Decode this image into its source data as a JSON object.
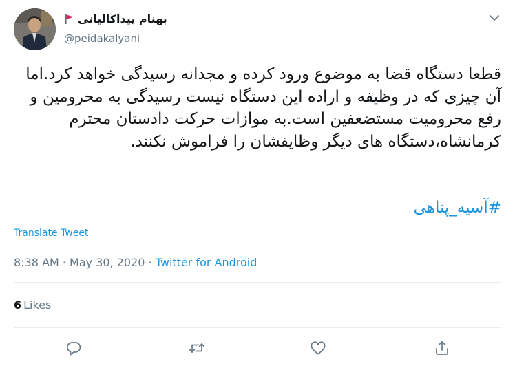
{
  "author": {
    "display_name": "بهنام پیداکالیانی",
    "handle": "@peidakalyani",
    "flag_icon": "red-flag-icon"
  },
  "tweet": {
    "text": "قطعا دستگاه قضا به موضوع ورود کرده و مجدانه رسیدگی خواهد کرد.اما آن چیزی که در وظیفه و اراده این دستگاه نیست رسیدگی به محرومین و رفع محرومیت مستضعفین است.به موازات حرکت دادستان محترم کرمانشاه،دستگاه های دیگر وظایفشان را فراموش نکنند.",
    "hashtag": "#آسیه_پناهی",
    "translate_label": "Translate Tweet"
  },
  "meta": {
    "time": "8:38 AM",
    "separator1": "·",
    "date": "May 30, 2020",
    "separator2": "·",
    "source": "Twitter for Android"
  },
  "stats": {
    "likes_count": "6",
    "likes_label": "Likes"
  },
  "actions": {
    "reply_icon": "reply-icon",
    "retweet_icon": "retweet-icon",
    "like_icon": "heart-icon",
    "share_icon": "share-icon",
    "menu_icon": "chevron-down-icon"
  },
  "colors": {
    "link": "#1b95e0",
    "secondary": "#657786",
    "text": "#14171a",
    "divider": "#e6ecf0",
    "icon": "#657786"
  }
}
